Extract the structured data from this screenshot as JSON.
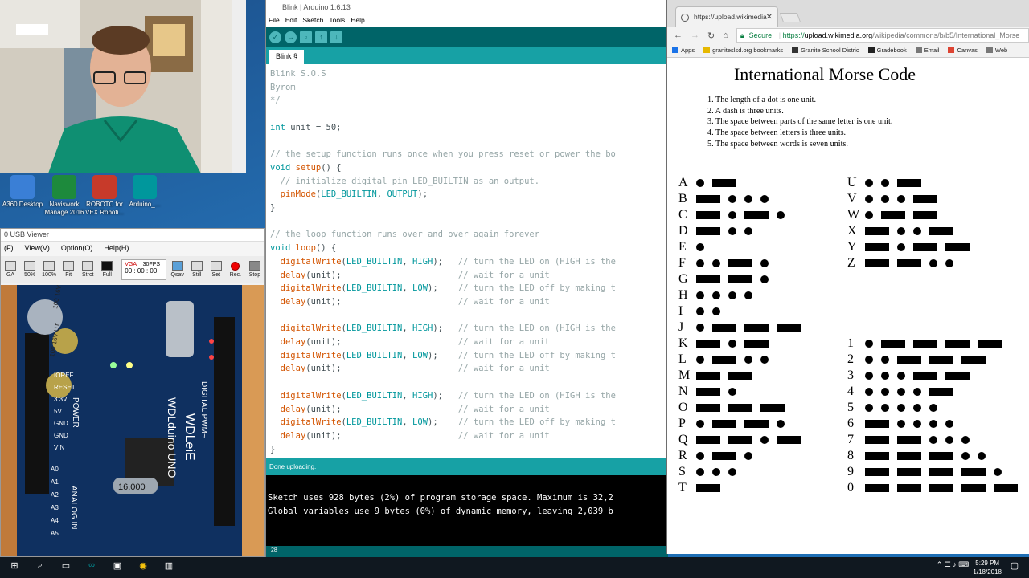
{
  "desktop": {
    "icons": [
      {
        "label": "A360 Desktop",
        "icon": "a360-icon",
        "color": "#3a7fd6"
      },
      {
        "label": "Naviswork Manage 2016",
        "icon": "navisworks-icon",
        "color": "#1d8a3c"
      },
      {
        "label": "ROBOTC for VEX Roboti...",
        "icon": "robotc-icon",
        "color": "#c73a2a"
      },
      {
        "label": "Arduino_...",
        "icon": "arduino-icon",
        "color": "#00979c"
      }
    ]
  },
  "usb_viewer": {
    "title": "0 USB Viewer",
    "menu": [
      "(F)",
      "View(V)",
      "Option(O)",
      "Help(H)"
    ],
    "toolbar": [
      {
        "label": "GA"
      },
      {
        "label": "50%"
      },
      {
        "label": "100%"
      },
      {
        "label": "Fit"
      },
      {
        "label": "Strct"
      },
      {
        "label": "Full"
      }
    ],
    "format": "VGA",
    "fps": "30FPS",
    "timer": "00 : 00 : 00",
    "actions": [
      {
        "label": "Qsav"
      },
      {
        "label": "Still"
      },
      {
        "label": "Set"
      },
      {
        "label": "Rec."
      },
      {
        "label": "Stop"
      }
    ],
    "board": {
      "crystal": "16.000",
      "brand": "WDLeiE",
      "model": "WDLduino UNO",
      "digital": "DIGITAL PWM~",
      "power": "POWER",
      "analog": "ANALOG IN",
      "cap1": "100 16V UT",
      "cap2": "100 16V UT",
      "pins_left": [
        "IOREF",
        "RESET",
        "3.3V",
        "5V",
        "GND",
        "GND",
        "VIN"
      ],
      "pins_analog": [
        "A0",
        "A1",
        "A2",
        "A3",
        "A4",
        "A5"
      ]
    }
  },
  "ide": {
    "title": "Blink | Arduino 1.6.13",
    "menu": [
      "File",
      "Edit",
      "Sketch",
      "Tools",
      "Help"
    ],
    "tab": "Blink §",
    "status": "Done uploading.",
    "console": [
      "Sketch uses 928 bytes (2%) of program storage space. Maximum is 32,2",
      "Global variables use 9 bytes (0%) of dynamic memory, leaving 2,039 b"
    ],
    "line_number": "28",
    "code": [
      {
        "t": "Blink S.O.S",
        "c": "cm"
      },
      {
        "t": "Byrom",
        "c": "cm"
      },
      {
        "t": "*/",
        "c": "cm"
      },
      {
        "t": "",
        "c": ""
      },
      {
        "t": "int unit = 50;",
        "c": "mix1"
      },
      {
        "t": "",
        "c": ""
      },
      {
        "t": "// the setup function runs once when you press reset or power the bo",
        "c": "cm"
      },
      {
        "t": "void setup() {",
        "c": "mix2"
      },
      {
        "t": "  // initialize digital pin LED_BUILTIN as an output.",
        "c": "cm"
      },
      {
        "t": "  pinMode(LED_BUILTIN, OUTPUT);",
        "c": "mix3"
      },
      {
        "t": "}",
        "c": ""
      },
      {
        "t": "",
        "c": ""
      },
      {
        "t": "// the loop function runs over and over again forever",
        "c": "cm"
      },
      {
        "t": "void loop() {",
        "c": "mix2"
      },
      {
        "t": "  digitalWrite(LED_BUILTIN, HIGH);   // turn the LED on (HIGH is the",
        "c": "dw"
      },
      {
        "t": "  delay(unit);                       // wait for a unit",
        "c": "dl"
      },
      {
        "t": "  digitalWrite(LED_BUILTIN, LOW);    // turn the LED off by making t",
        "c": "dw"
      },
      {
        "t": "  delay(unit);                       // wait for a unit",
        "c": "dl"
      },
      {
        "t": "",
        "c": ""
      },
      {
        "t": "  digitalWrite(LED_BUILTIN, HIGH);   // turn the LED on (HIGH is the",
        "c": "dw"
      },
      {
        "t": "  delay(unit);                       // wait for a unit",
        "c": "dl"
      },
      {
        "t": "  digitalWrite(LED_BUILTIN, LOW);    // turn the LED off by making t",
        "c": "dw"
      },
      {
        "t": "  delay(unit);                       // wait for a unit",
        "c": "dl"
      },
      {
        "t": "",
        "c": ""
      },
      {
        "t": "  digitalWrite(LED_BUILTIN, HIGH);   // turn the LED on (HIGH is the",
        "c": "dw"
      },
      {
        "t": "  delay(unit);                       // wait for a unit",
        "c": "dl"
      },
      {
        "t": "  digitalWrite(LED_BUILTIN, LOW);    // turn the LED off by making t",
        "c": "dw"
      },
      {
        "t": "  delay(unit);                       // wait for a unit",
        "c": "dl"
      },
      {
        "t": "}",
        "c": ""
      }
    ]
  },
  "chrome": {
    "tab_title": "https://upload.wikimedia",
    "secure_label": "Secure",
    "url_scheme": "https://",
    "url_host": "upload.wikimedia.org",
    "url_path": "/wikipedia/commons/b/b5/International_Morse",
    "bookmarks": [
      "Apps",
      "graniteslsd.org bookmarks",
      "Granite School Distric",
      "Gradebook",
      "Email",
      "Canvas",
      "Web"
    ],
    "page": {
      "title": "International Morse Code",
      "rules": [
        "1. The length of a dot is one unit.",
        "2. A dash is three units.",
        "3. The space between parts of the same letter is one unit.",
        "4. The space between letters is three units.",
        "5. The space between words is seven units."
      ],
      "letters_left": [
        {
          "ch": "A",
          "code": ".-"
        },
        {
          "ch": "B",
          "code": "-..."
        },
        {
          "ch": "C",
          "code": "-.-."
        },
        {
          "ch": "D",
          "code": "-.."
        },
        {
          "ch": "E",
          "code": "."
        },
        {
          "ch": "F",
          "code": "..-."
        },
        {
          "ch": "G",
          "code": "--."
        },
        {
          "ch": "H",
          "code": "...."
        },
        {
          "ch": "I",
          "code": ".."
        },
        {
          "ch": "J",
          "code": ".---"
        },
        {
          "ch": "K",
          "code": "-.-"
        },
        {
          "ch": "L",
          "code": ".-.."
        },
        {
          "ch": "M",
          "code": "--"
        },
        {
          "ch": "N",
          "code": "-."
        },
        {
          "ch": "O",
          "code": "---"
        },
        {
          "ch": "P",
          "code": ".--."
        },
        {
          "ch": "Q",
          "code": "--.-"
        },
        {
          "ch": "R",
          "code": ".-."
        },
        {
          "ch": "S",
          "code": "..."
        },
        {
          "ch": "T",
          "code": "-"
        }
      ],
      "letters_right": [
        {
          "ch": "U",
          "code": "..-"
        },
        {
          "ch": "V",
          "code": "...-"
        },
        {
          "ch": "W",
          "code": ".--"
        },
        {
          "ch": "X",
          "code": "-..-"
        },
        {
          "ch": "Y",
          "code": "-.--"
        },
        {
          "ch": "Z",
          "code": "--.."
        }
      ],
      "digits": [
        {
          "ch": "1",
          "code": ".----"
        },
        {
          "ch": "2",
          "code": "..---"
        },
        {
          "ch": "3",
          "code": "...--"
        },
        {
          "ch": "4",
          "code": "....-"
        },
        {
          "ch": "5",
          "code": "....."
        },
        {
          "ch": "6",
          "code": "-...."
        },
        {
          "ch": "7",
          "code": "--..."
        },
        {
          "ch": "8",
          "code": "---.."
        },
        {
          "ch": "9",
          "code": "----."
        },
        {
          "ch": "0",
          "code": "-----"
        }
      ]
    }
  },
  "taskbar": {
    "time": "5:29 PM",
    "date": "1/18/2018"
  },
  "colors": {
    "arduino_dark": "#006468",
    "arduino_teal": "#17a1a5",
    "desktop_blue": "#1f6fb5"
  }
}
